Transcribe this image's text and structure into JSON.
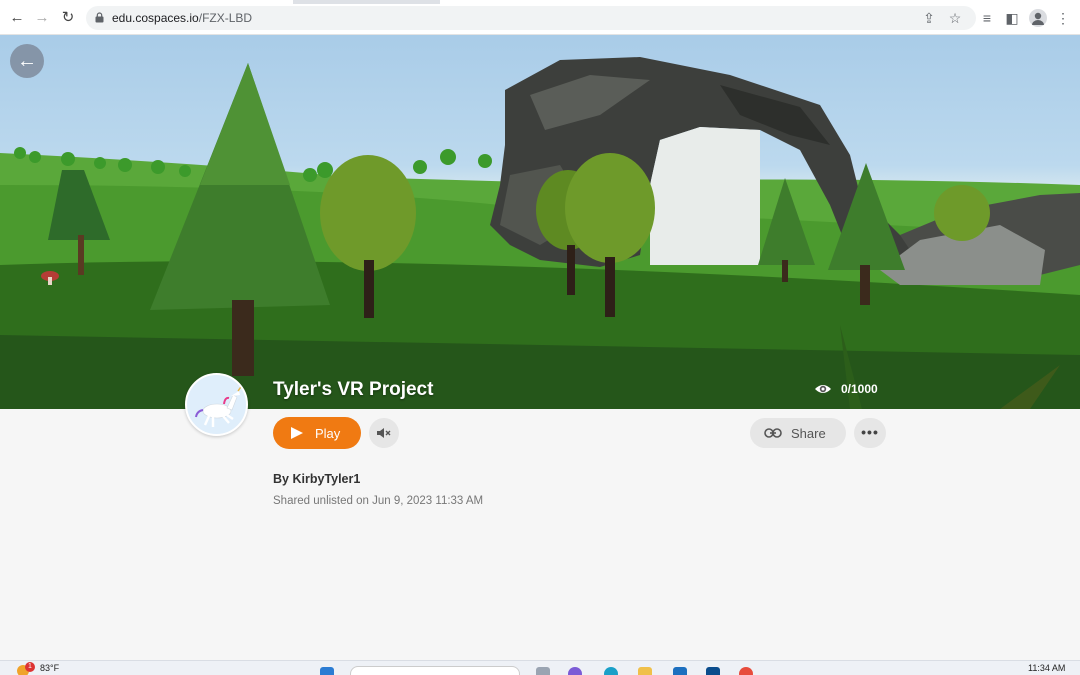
{
  "browser": {
    "url_host": "edu.cospaces.io",
    "url_path": "/FZX-LBD",
    "icons": [
      "back-icon",
      "forward-icon",
      "reload-icon",
      "lock-icon",
      "share-page-icon",
      "bookmark-star-icon",
      "reading-list-icon",
      "side-panel-icon",
      "profile-icon",
      "menu-icon"
    ]
  },
  "scene": {
    "back_icon": "arrow-left-icon"
  },
  "project": {
    "title": "Tyler's VR Project",
    "views": "0/1000",
    "author_prefix": "By",
    "author": "KirbyTyler1",
    "shared": "Shared unlisted on Jun 9, 2023 11:33 AM"
  },
  "actions": {
    "play_label": "Play",
    "share_label": "Share",
    "more_label": "•••"
  },
  "taskbar": {
    "weather_badge": "1",
    "temperature": "83°F",
    "time": "11:34 AM"
  },
  "colors": {
    "accent": "#f07a12",
    "page_bg": "#f6f6f6"
  }
}
